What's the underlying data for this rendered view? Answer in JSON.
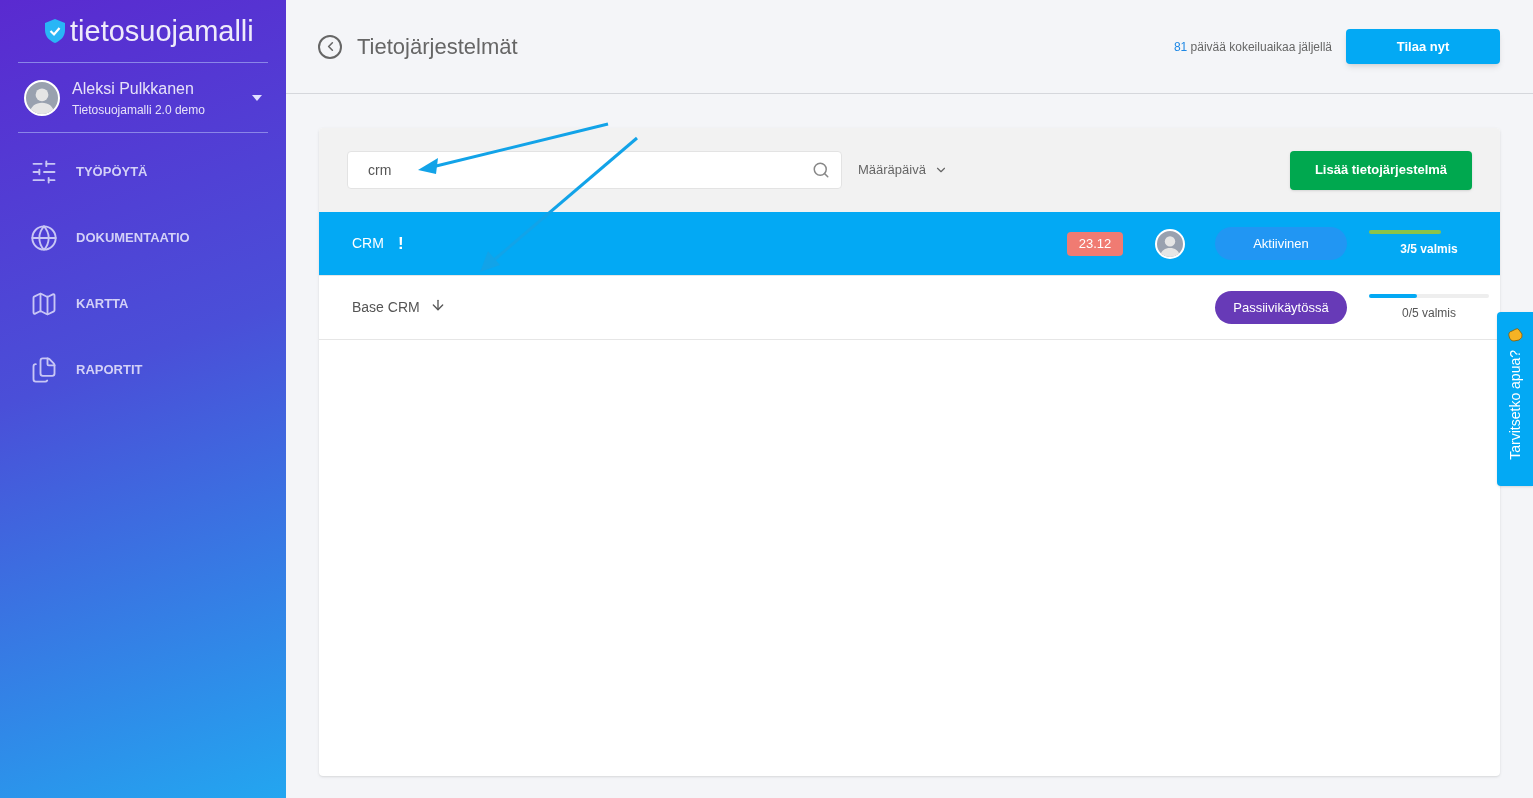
{
  "sidebar": {
    "logo": "tietosuojamalli",
    "user": {
      "name": "Aleksi Pulkkanen",
      "org": "Tietosuojamalli 2.0 demo"
    },
    "items": [
      {
        "label": "TYÖPÖYTÄ",
        "selected": false
      },
      {
        "label": "DOKUMENTAATIO",
        "selected": false
      },
      {
        "label": "KARTTA",
        "selected": false
      },
      {
        "label": "RAPORTIT",
        "selected": false
      }
    ]
  },
  "header": {
    "title": "Tietojärjestelmät",
    "trial_days": "81",
    "trial_text": "päivää kokeiluaikaa jäljellä",
    "order_button": "Tilaa nyt"
  },
  "toolbar": {
    "search_value": "crm",
    "sort_label": "Määräpäivä",
    "add_button": "Lisää tietojärjestelmä"
  },
  "rows": [
    {
      "name": "CRM",
      "selected": true,
      "marker": {
        "kind": "alert",
        "text": "!"
      },
      "due": "23.12",
      "owner_avatar": true,
      "status": {
        "label": "Aktiivinen",
        "color": "#2196f3"
      },
      "progress": {
        "level": 0.6,
        "label": "3/5 valmis",
        "color": "#8bc34a"
      }
    },
    {
      "name": "Base CRM",
      "selected": false,
      "marker": {
        "kind": "down-arrow"
      },
      "owner_avatar": false,
      "status": {
        "label": "Passiivikäytössä",
        "color": "#673ab7"
      },
      "progress": {
        "level": 0.4,
        "label": "0/5 valmis",
        "color": "#03a9f4"
      }
    }
  ],
  "help_tab": "Tarvitsetko apua?"
}
